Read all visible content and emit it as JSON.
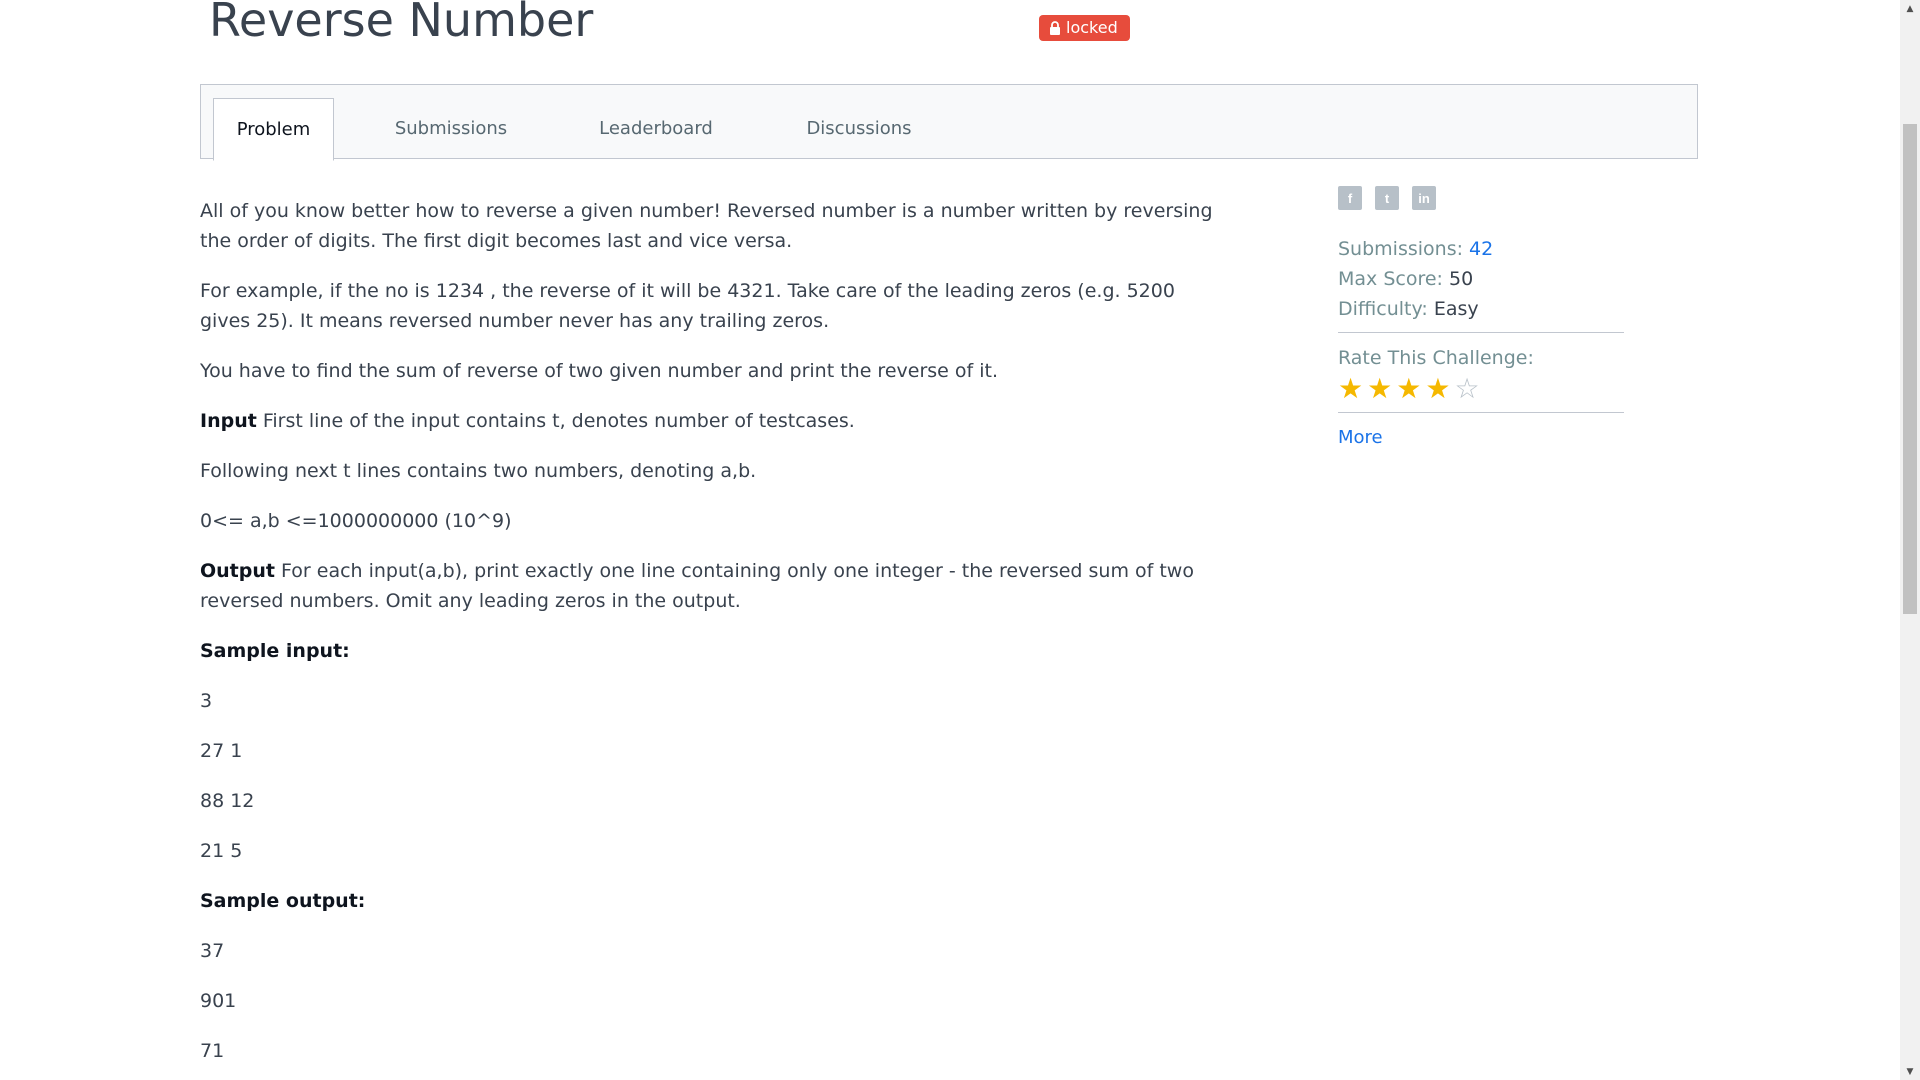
{
  "header": {
    "title": "Reverse Number",
    "badge": "locked"
  },
  "tabs": [
    {
      "label": "Problem",
      "active": true
    },
    {
      "label": "Submissions",
      "active": false
    },
    {
      "label": "Leaderboard",
      "active": false
    },
    {
      "label": "Discussions",
      "active": false
    }
  ],
  "problem": {
    "para1": "All of you know better how to reverse a given number! Reversed number is a number written by reversing the order of digits. The first digit becomes last and vice versa.",
    "para2": "For example, if the no is 1234 , the reverse of it will be 4321. Take care of the leading zeros (e.g. 5200 gives 25). It means reversed number never has any trailing zeros.",
    "para3": "You have to find the sum of reverse of two given number and print the reverse of it.",
    "input_label": "Input",
    "input_text": " First line of the input contains t, denotes number of testcases.",
    "para5": "Following next t lines contains two numbers, denoting a,b.",
    "constraint": "0<= a,b <=1000000000 (10^9)",
    "output_label": "Output",
    "output_text": " For each input(a,b), print exactly one line containing only one integer - the reversed sum of two reversed numbers. Omit any leading zeros in the output.",
    "sample_input_label": "Sample input:",
    "sample_input": [
      "3",
      "27 1",
      "88 12",
      "21 5"
    ],
    "sample_output_label": "Sample output:",
    "sample_output": [
      "37",
      "901",
      "71"
    ]
  },
  "sidebar": {
    "share_icons": [
      {
        "name": "facebook-icon",
        "glyph": "f"
      },
      {
        "name": "twitter-icon",
        "glyph": "t"
      },
      {
        "name": "linkedin-icon",
        "glyph": "in"
      }
    ],
    "submissions_label": "Submissions:",
    "submissions_value": "42",
    "max_score_label": "Max Score:",
    "max_score_value": "50",
    "difficulty_label": "Difficulty:",
    "difficulty_value": "Easy",
    "rate_label": "Rate This Challenge:",
    "rating": 4,
    "rating_max": 5,
    "more_label": "More"
  },
  "colors": {
    "badge": "#e74c3c",
    "star_filled": "#f5b800",
    "star_empty": "#b7c0c8",
    "link": "#1a73e8"
  }
}
